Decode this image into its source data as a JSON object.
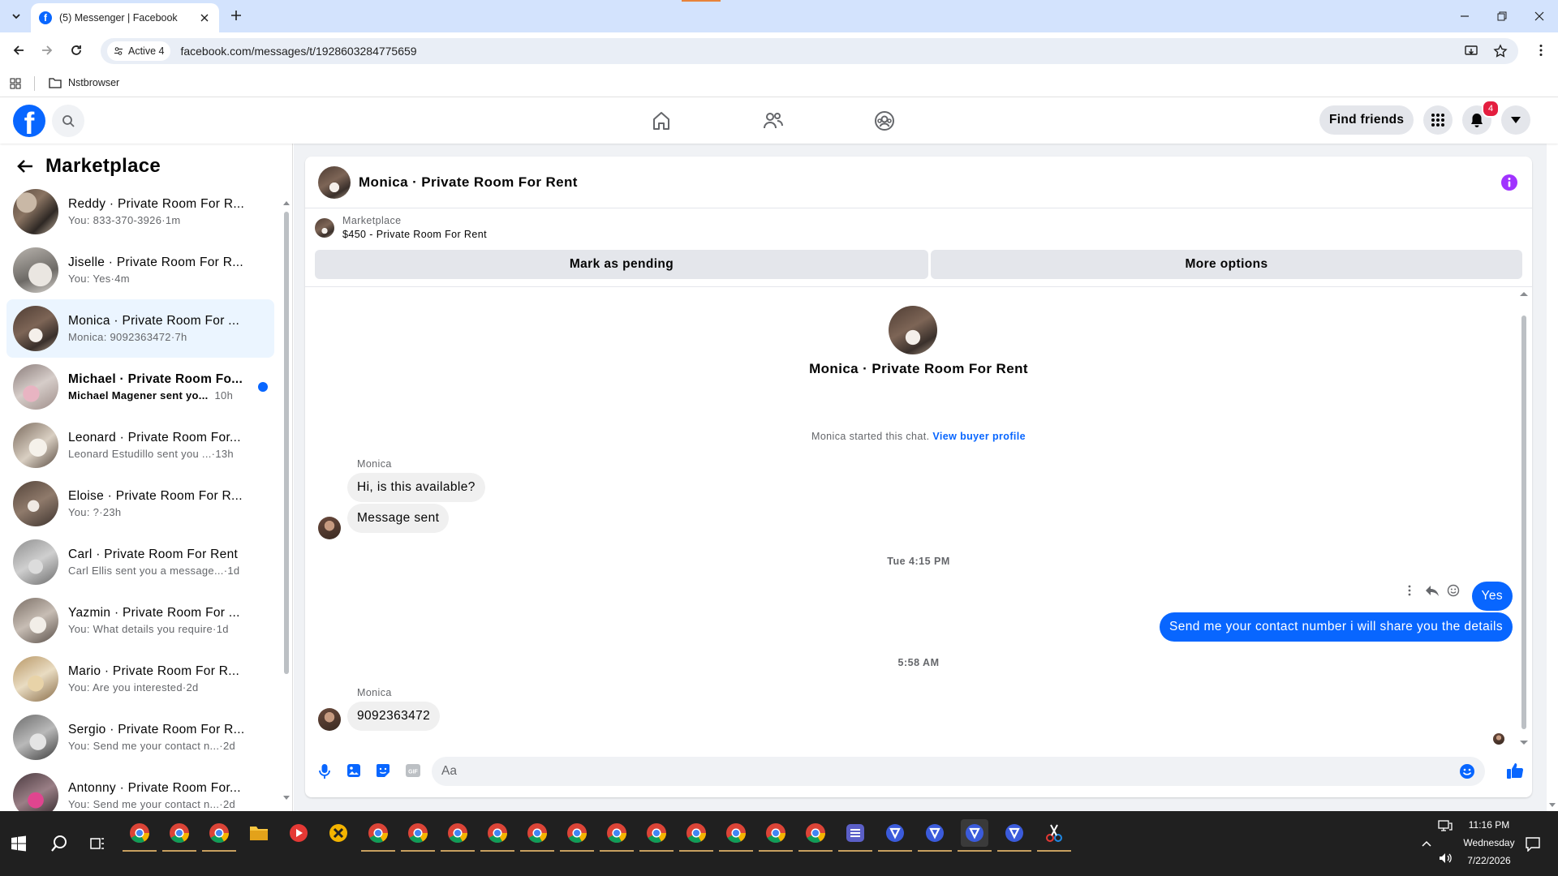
{
  "browser": {
    "tab_title": "(5) Messenger | Facebook",
    "site_info": "Active 4",
    "url": "facebook.com/messages/t/1928603284775659",
    "bookmark_folder": "Nstbrowser"
  },
  "header": {
    "find_friends": "Find friends",
    "notification_count": "4"
  },
  "sidebar": {
    "title": "Marketplace",
    "conversations": [
      {
        "name": "Reddy · Private Room For R...",
        "preview": "You: 833-370-3926",
        "time": "1m"
      },
      {
        "name": "Jiselle · Private Room For R...",
        "preview": "You: Yes",
        "time": "4m"
      },
      {
        "name": "Monica · Private Room For ...",
        "preview": "Monica: 9092363472",
        "time": "7h"
      },
      {
        "name": "Michael · Private Room Fo...",
        "preview": "Michael Magener sent yo...",
        "time": "10h"
      },
      {
        "name": "Leonard · Private Room For...",
        "preview": "Leonard Estudillo sent you ...",
        "time": "13h"
      },
      {
        "name": "Eloise · Private Room For R...",
        "preview": "You: ?",
        "time": "23h"
      },
      {
        "name": "Carl · Private Room For Rent",
        "preview": "Carl Ellis sent you a message...",
        "time": "1d"
      },
      {
        "name": "Yazmin · Private Room For ...",
        "preview": "You: What details you require",
        "time": "1d"
      },
      {
        "name": "Mario · Private Room For R...",
        "preview": "You: Are you interested",
        "time": "2d"
      },
      {
        "name": "Sergio · Private Room For R...",
        "preview": "You: Send me your contact n...",
        "time": "2d"
      },
      {
        "name": "Antonny · Private Room For...",
        "preview": "You: Send me your contact n...",
        "time": "2d"
      }
    ]
  },
  "chat": {
    "title": "Monica · Private Room For Rent",
    "listing_source": "Marketplace",
    "listing": "$450 - Private Room For Rent",
    "mark_pending": "Mark as pending",
    "more_options": "More options",
    "profile_name": "Monica · Private Room For Rent",
    "started_text": "Monica started this chat.",
    "view_profile": "View buyer profile",
    "sender1": "Monica",
    "msg1": "Hi, is this available?",
    "msg2": "Message sent",
    "time1": "Tue 4:15 PM",
    "out1": "Yes",
    "out2": "Send me your contact number i will share you the details",
    "time2": "5:58 AM",
    "sender2": "Monica",
    "msg3": "9092363472",
    "composer_placeholder": "Aa"
  },
  "taskbar": {
    "time": "11:16 PM",
    "day": "Wednesday",
    "date": "7/22/2026"
  },
  "colors": {
    "accent": "#0866ff",
    "badge": "#e41e3f",
    "info": "#a033ff"
  }
}
